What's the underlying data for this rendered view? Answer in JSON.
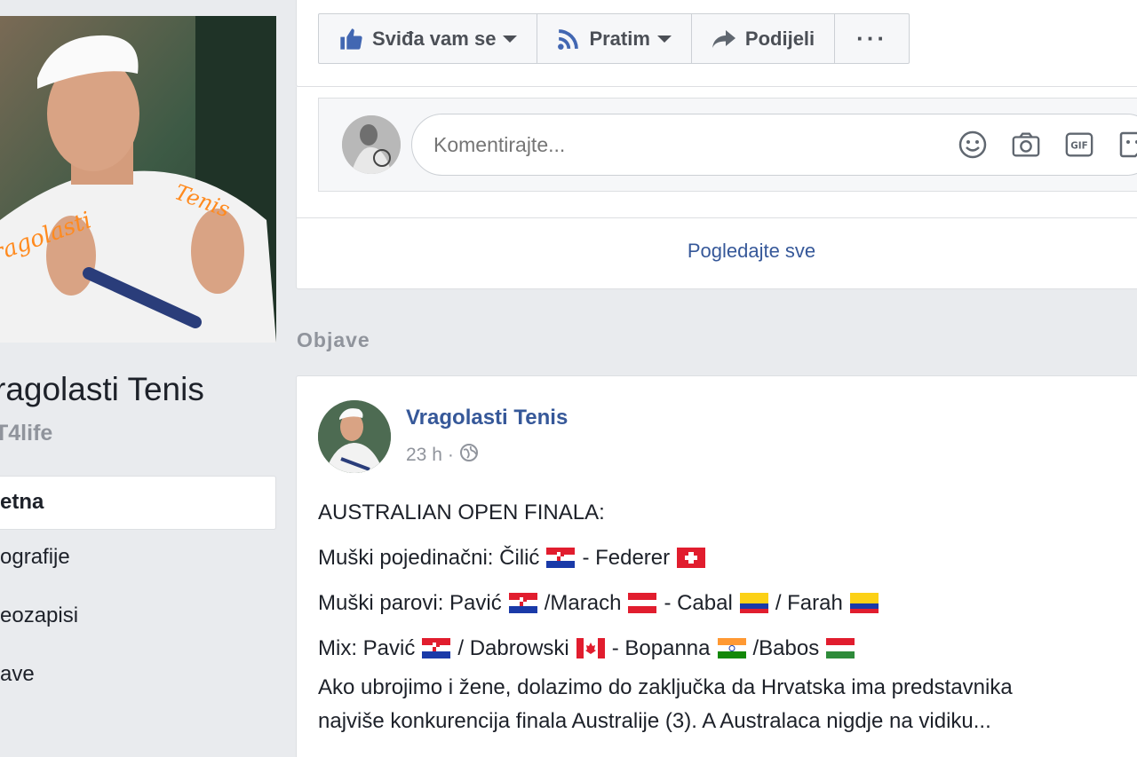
{
  "page": {
    "name": "ragolasti Tenis",
    "handle": "T4life"
  },
  "nav": {
    "items": [
      {
        "label": "etna",
        "active": true
      },
      {
        "label": "ografije",
        "active": false
      },
      {
        "label": "eozapisi",
        "active": false
      },
      {
        "label": "ave",
        "active": false
      }
    ]
  },
  "actions": {
    "like": "Sviđa vam se",
    "follow": "Pratim",
    "share": "Podijeli",
    "more": "···"
  },
  "comment": {
    "placeholder": "Komentirajte...",
    "icons": [
      "emoji-icon",
      "camera-icon",
      "gif-icon",
      "sticker-icon"
    ]
  },
  "see_all": "Pogledajte sve",
  "section_title": "Objave",
  "post": {
    "author": "Vragolasti Tenis",
    "time": "23 h",
    "dot": "·",
    "lines": {
      "title": "AUSTRALIAN OPEN FINALA:",
      "l1a": "Muški pojedinačni: Čilić",
      "l1b": "- Federer",
      "l2a": "Muški parovi: Pavić",
      "l2b": "/Marach",
      "l2c": "- Cabal",
      "l2d": "/ Farah",
      "l3a": "Mix: Pavić",
      "l3b": "/ Dabrowski",
      "l3c": "- Bopanna",
      "l3d": "/Babos",
      "p1": "Ako ubrojimo i žene, dolazimo do zaključka da Hrvatska ima predstavnika",
      "p2": "najviše konkurencija finala Australije (3). A Australaca nigdje na vidiku..."
    }
  },
  "colors": {
    "link": "#365899",
    "background": "#e9ebee",
    "accent": "#4267b2"
  }
}
